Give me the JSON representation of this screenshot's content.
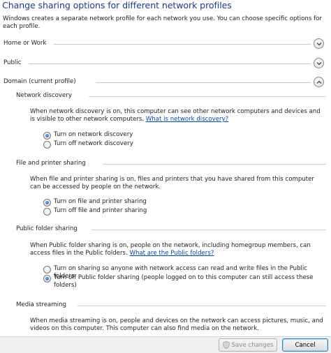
{
  "header": {
    "title": "Change sharing options for different network profiles",
    "description": "Windows creates a separate network profile for each network you use. You can choose specific options for each profile."
  },
  "profiles": [
    {
      "label": "Home or Work",
      "expanded": false
    },
    {
      "label": "Public",
      "expanded": false
    },
    {
      "label": "Domain (current profile)",
      "expanded": true
    }
  ],
  "network_discovery": {
    "heading": "Network discovery",
    "description": "When network discovery is on, this computer can see other network computers and devices and is visible to other network computers.",
    "link": "What is network discovery?",
    "options": [
      "Turn on network discovery",
      "Turn off network discovery"
    ],
    "selected": 0
  },
  "file_printer": {
    "heading": "File and printer sharing",
    "description": "When file and printer sharing is on, files and printers that you have shared from this computer can be accessed by people on the network.",
    "options": [
      "Turn on file and printer sharing",
      "Turn off file and printer sharing"
    ],
    "selected": 0
  },
  "public_folder": {
    "heading": "Public folder sharing",
    "description": "When Public folder sharing is on, people on the network, including homegroup members, can access files in the Public folders.",
    "link": "What are the Public folders?",
    "options": [
      "Turn on sharing so anyone with network access can read and write files in the Public folders",
      "Turn off Public folder sharing (people logged on to this computer can still access these folders)"
    ],
    "selected": 1
  },
  "media_streaming": {
    "heading": "Media streaming",
    "description": "When media streaming is on, people and devices on the network can access pictures, music, and videos on this computer. This computer can also find media on the network."
  },
  "buttons": {
    "save": "Save changes",
    "cancel": "Cancel"
  },
  "colors": {
    "title": "#1e3b8a",
    "link": "#0645ad"
  }
}
